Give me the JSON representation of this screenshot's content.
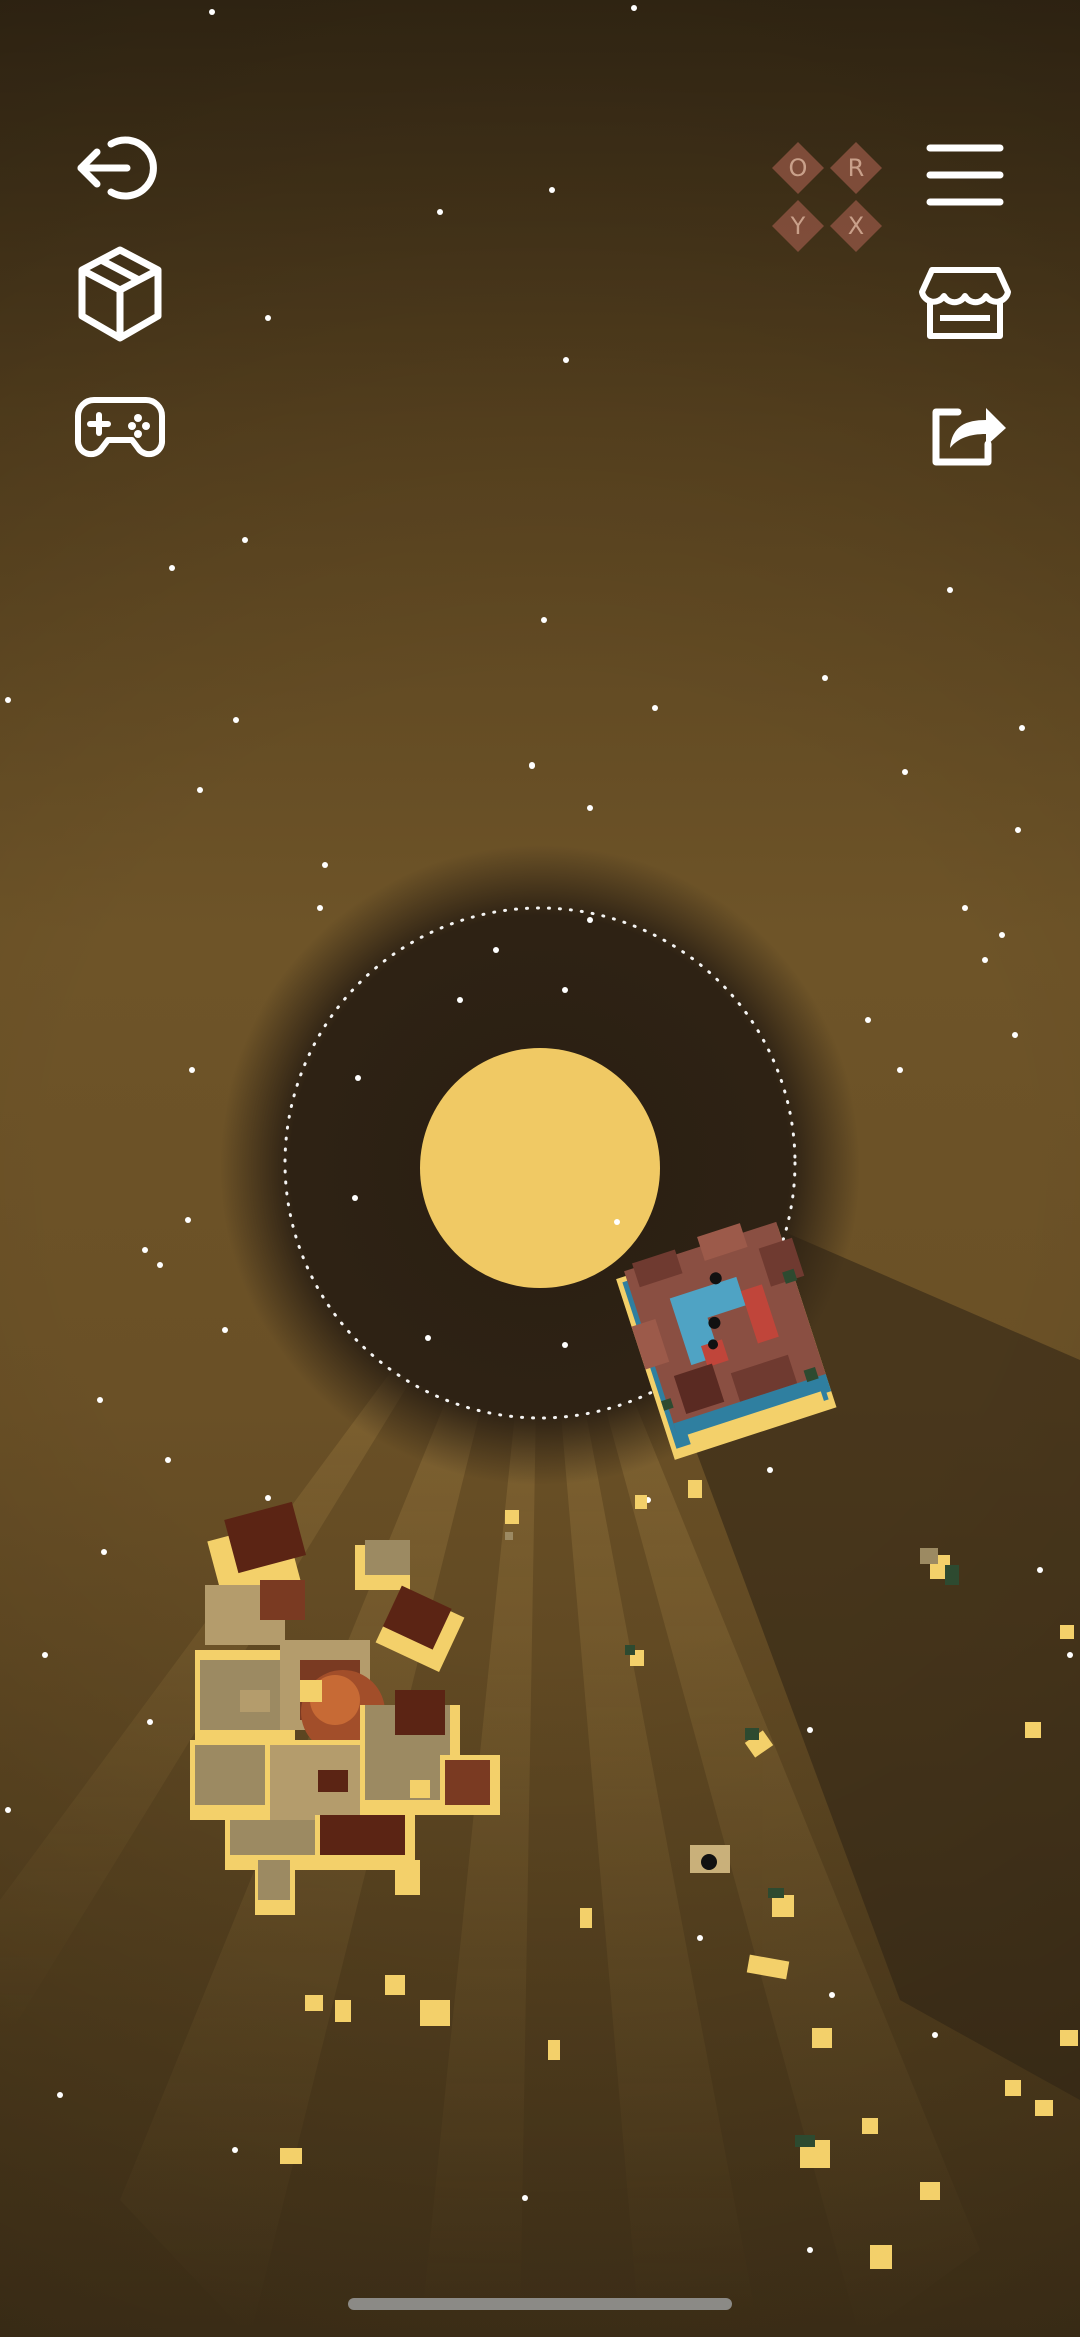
{
  "app": {
    "logo_letters": [
      "O",
      "R",
      "Y",
      "X"
    ]
  },
  "toolbar_left": {
    "icons": [
      "exit-icon",
      "cube-icon",
      "gamepad-icon"
    ]
  },
  "toolbar_right": {
    "icons": [
      "menu-icon",
      "store-icon",
      "share-icon"
    ]
  },
  "scene": {
    "colors": {
      "sky": "#6e5428",
      "sun": "#f0c964",
      "shadow_disc": "#2e2214",
      "stars": "#ffffff",
      "planet_soil": "#8a4f42",
      "planet_water": "#4fa3c4",
      "asteroid_light": "#b49c6c",
      "asteroid_rim": "#f3d06a",
      "asteroid_dark": "#5b2414"
    }
  }
}
